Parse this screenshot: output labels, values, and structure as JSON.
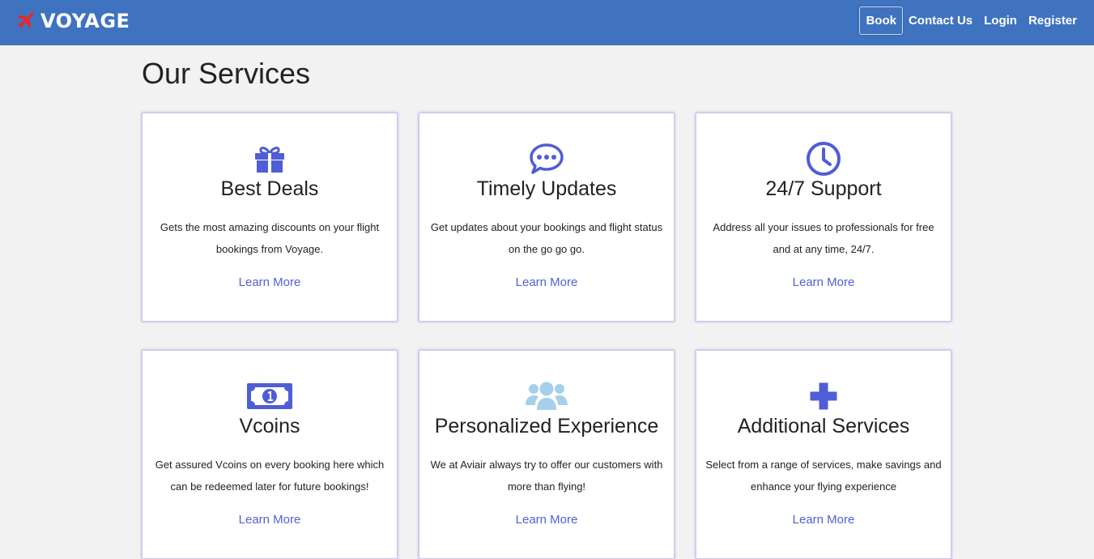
{
  "brand": {
    "name": "VOYAGE",
    "icon": "airplane-icon"
  },
  "nav": {
    "items": [
      {
        "label": "Book",
        "active": true
      },
      {
        "label": "Contact Us",
        "active": false
      },
      {
        "label": "Login",
        "active": false
      },
      {
        "label": "Register",
        "active": false
      }
    ]
  },
  "page": {
    "title": "Our Services"
  },
  "colors": {
    "navbar": "#3f73bf",
    "accent": "#5060d8",
    "icon_primary": "#4f5dd6",
    "icon_light": "#a6d0ea",
    "brand_icon": "#e8272a"
  },
  "services": [
    {
      "icon": "gift-icon",
      "title": "Best Deals",
      "text": "Gets the most amazing discounts on your flight bookings from Voyage.",
      "link": "Learn More"
    },
    {
      "icon": "chat-bubble-icon",
      "title": "Timely Updates",
      "text": "Get updates about your bookings and flight status on the go go go.",
      "link": "Learn More"
    },
    {
      "icon": "clock-icon",
      "title": "24/7 Support",
      "text": "Address all your issues to professionals for free and at any time, 24/7.",
      "link": "Learn More"
    },
    {
      "icon": "money-bill-icon",
      "title": "Vcoins",
      "text": "Get assured Vcoins on every booking here which can be redeemed later for future bookings!",
      "link": "Learn More"
    },
    {
      "icon": "users-icon",
      "title": "Personalized Experience",
      "text": "We at Aviair always try to offer our customers with more than flying!",
      "link": "Learn More"
    },
    {
      "icon": "plus-icon",
      "title": "Additional Services",
      "text": "Select from a range of services, make savings and enhance your flying experience",
      "link": "Learn More"
    }
  ]
}
